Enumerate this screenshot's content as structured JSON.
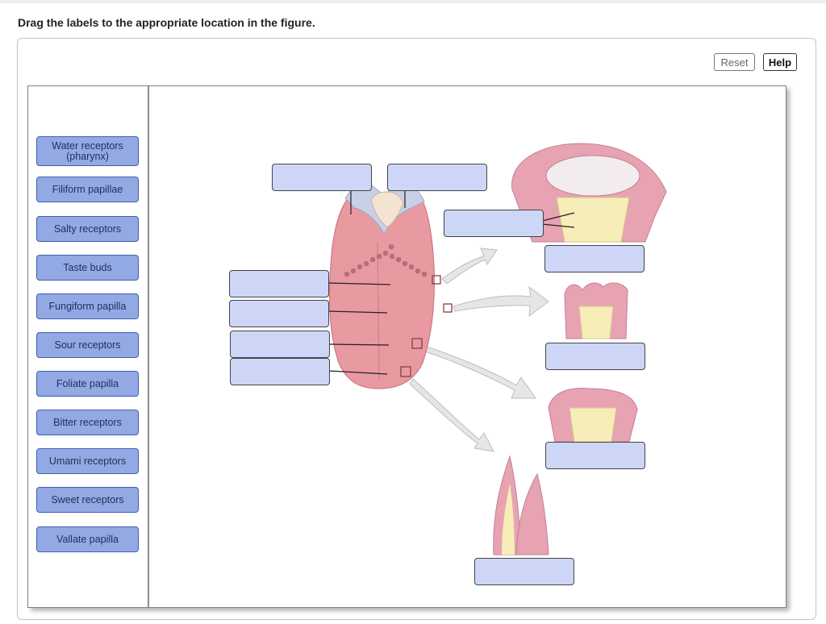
{
  "instruction": "Drag the labels to the appropriate location in the figure.",
  "toolbar": {
    "reset_label": "Reset",
    "help_label": "Help"
  },
  "labels": [
    {
      "text": "Water receptors (pharynx)"
    },
    {
      "text": "Filiform papillae"
    },
    {
      "text": "Salty receptors"
    },
    {
      "text": "Taste buds"
    },
    {
      "text": "Fungiform papilla"
    },
    {
      "text": "Sour receptors"
    },
    {
      "text": "Foliate papilla"
    },
    {
      "text": "Bitter receptors"
    },
    {
      "text": "Umami receptors"
    },
    {
      "text": "Sweet receptors"
    },
    {
      "text": "Vallate papilla"
    }
  ],
  "targets": [
    {
      "id": "top-left"
    },
    {
      "id": "top-right"
    },
    {
      "id": "taste-bud-pointer"
    },
    {
      "id": "tongue-left-1"
    },
    {
      "id": "tongue-left-2"
    },
    {
      "id": "tongue-left-3"
    },
    {
      "id": "tongue-left-4"
    },
    {
      "id": "vallate-section"
    },
    {
      "id": "foliate-section"
    },
    {
      "id": "fungiform-section"
    },
    {
      "id": "filiform-section"
    }
  ],
  "colors": {
    "chip_fill": "#92a9e4",
    "chip_border": "#3f5fae",
    "target_fill": "#cdd6f7",
    "tongue": "#e99aa0"
  }
}
